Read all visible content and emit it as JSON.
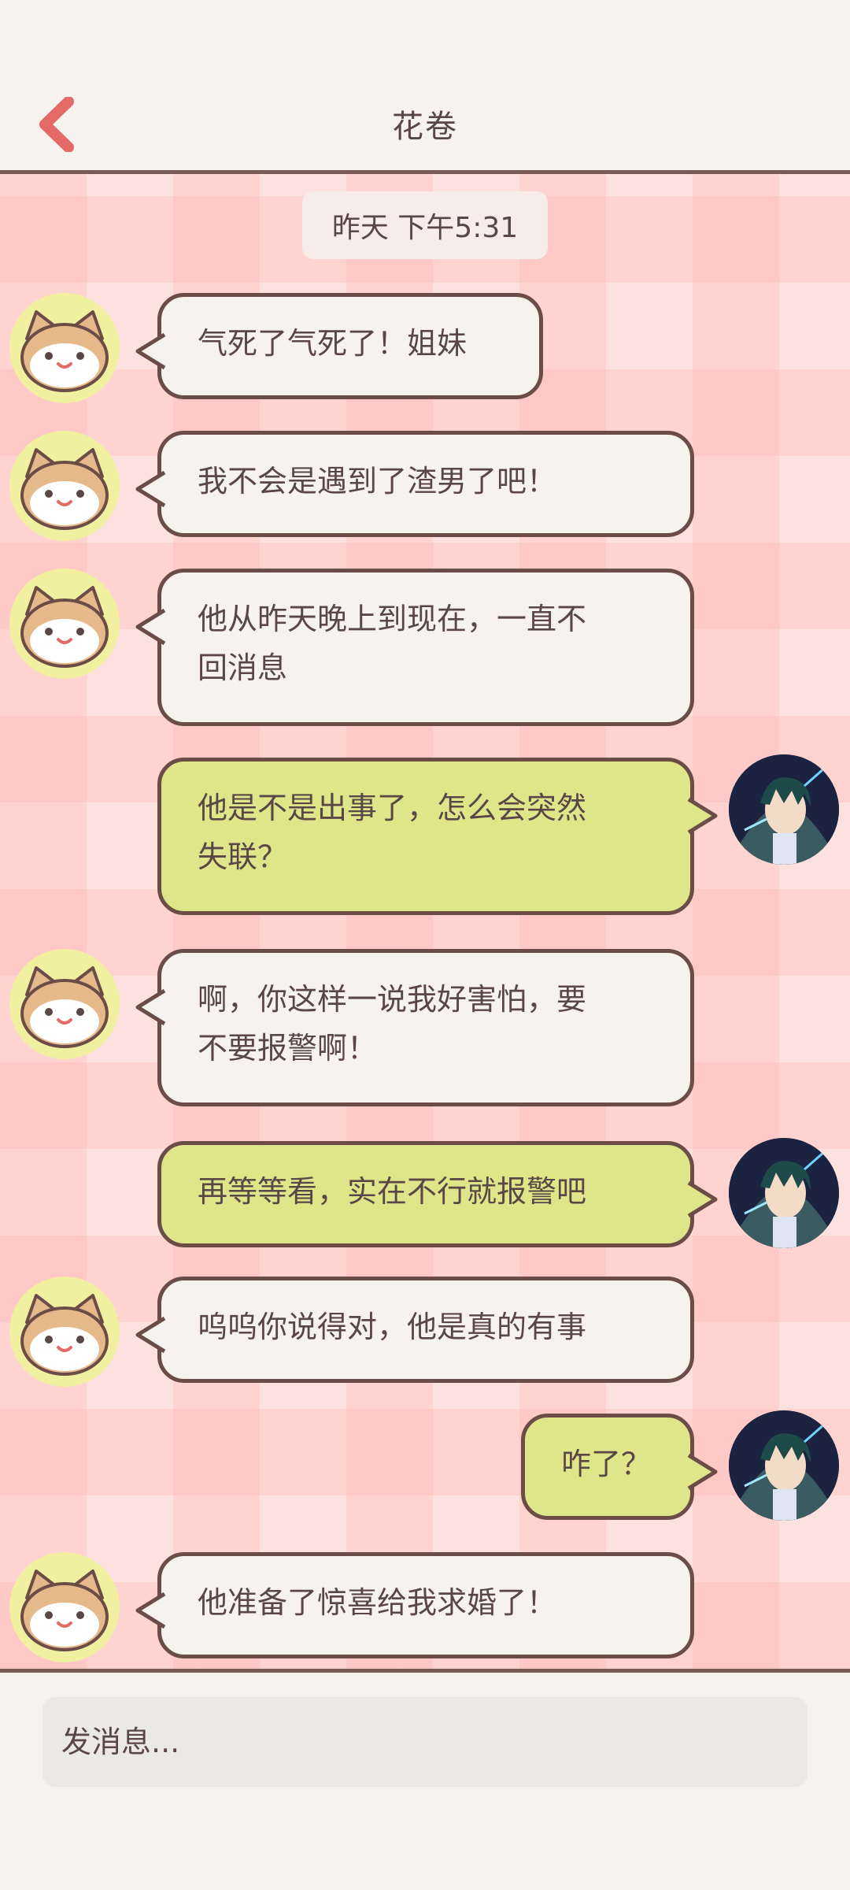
{
  "header": {
    "title": "花卷",
    "back_icon": "chevron-left-icon"
  },
  "colors": {
    "accent": "#e46a68",
    "border": "#6b4c47",
    "incoming_bubble": "#f6f3ee",
    "outgoing_bubble": "#dfe68a",
    "text": "#5a4646"
  },
  "chat": {
    "timestamp": "昨天 下午5:31",
    "messages": [
      {
        "from": "other",
        "text": "气死了气死了！姐妹"
      },
      {
        "from": "other",
        "text": "我不会是遇到了渣男了吧！"
      },
      {
        "from": "other",
        "lines": [
          "他从昨天晚上到现在，一直不",
          "回消息"
        ]
      },
      {
        "from": "me",
        "lines": [
          "他是不是出事了，怎么会突然",
          "失联？"
        ]
      },
      {
        "from": "other",
        "lines": [
          "啊，你这样一说我好害怕，要",
          "不要报警啊！"
        ]
      },
      {
        "from": "me",
        "text": "再等等看，实在不行就报警吧"
      },
      {
        "from": "other",
        "text": "呜呜你说得对，他是真的有事"
      },
      {
        "from": "me",
        "text": "咋了？"
      },
      {
        "from": "other",
        "text": "他准备了惊喜给我求婚了！"
      }
    ]
  },
  "composer": {
    "placeholder": "发消息..."
  }
}
